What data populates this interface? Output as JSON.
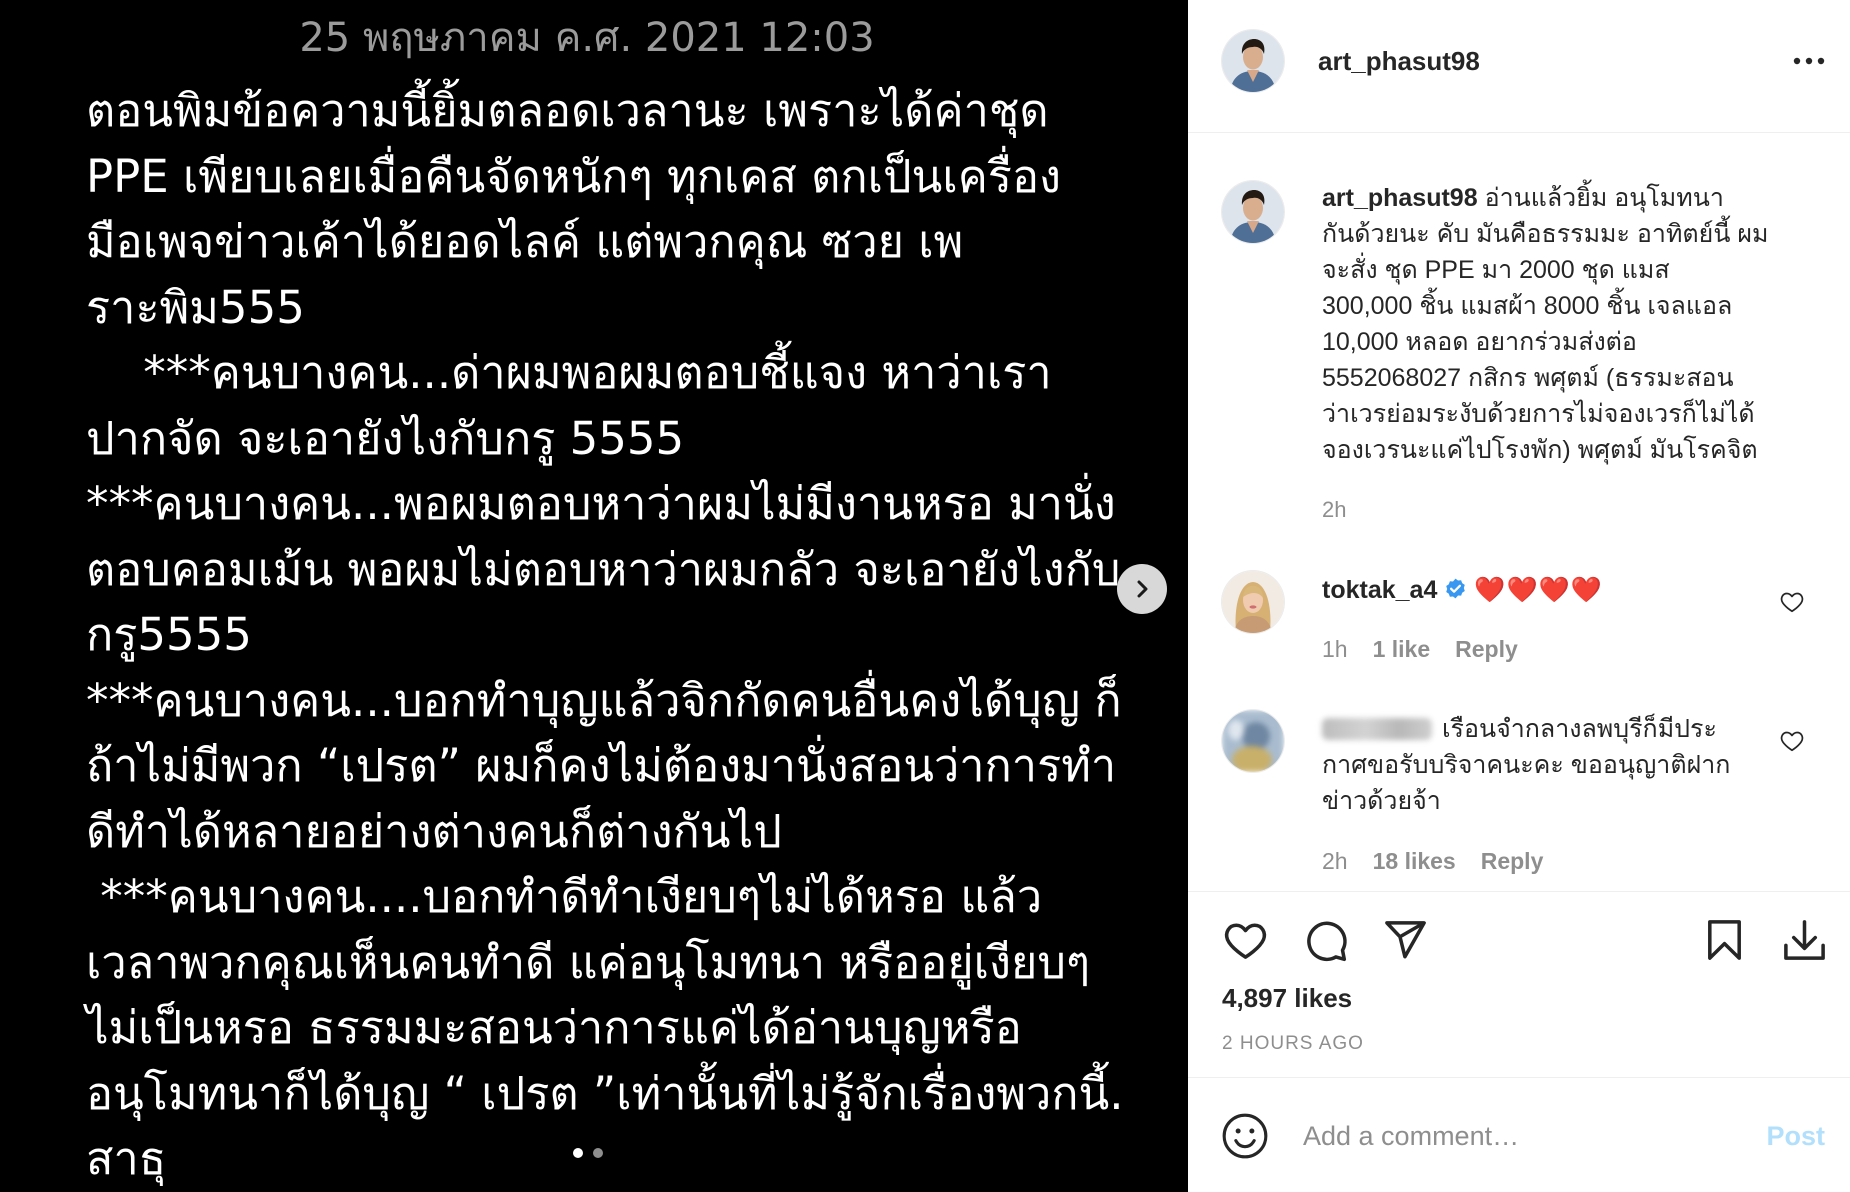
{
  "post_image": {
    "date": "25 พฤษภาคม ค.ศ. 2021 12:03",
    "lines": [
      "ตอนพิมข้อความนี้ยิ้มตลอดเวลานะ เพราะได้ค่าชุด",
      "PPE เพียบเลยเมื่อคืนจัดหนักๆ ทุกเคส ตกเป็นเครื่อง",
      "มือเพจข่าวเค้าได้ยอดไลค์ แต่พวกคุณ ซวย เพ",
      "ราะพิม555",
      "    ***คนบางคน...ด่าผมพอผมตอบชี้แจง หาว่าเรา",
      "ปากจัด จะเอายังไงกับกรู 5555",
      "***คนบางคน...พอผมตอบหาว่าผมไม่มีงานหรอ มานั่ง",
      "ตอบคอมเม้น พอผมไม่ตอบหาว่าผมกลัว จะเอายังไงกับ",
      "กรู5555",
      "***คนบางคน...บอกทำบุญแล้วจิกกัดคนอื่นคงได้บุญ ก็",
      "ถ้าไม่มีพวก “เปรต” ผมก็คงไม่ต้องมานั่งสอนว่าการทำ",
      "ดีทำได้หลายอย่างต่างคนก็ต่างกันไป",
      " ***คนบางคน....บอกทำดีทำเงียบๆไม่ได้หรอ แล้ว",
      "เวลาพวกคุณเห็นคนทำดี แค่อนุโมทนา หรืออยู่เงียบๆ",
      "ไม่เป็นหรอ ธรรมมะสอนว่าการแค่ได้อ่านบุญหรือ",
      "อนุโมทนาก็ได้บุญ “ เปรต ”เท่านั้นที่ไม่รู้จักเรื่องพวกนี้.",
      "สาธุ"
    ]
  },
  "carousel": {
    "next_icon": "chevron-right-icon",
    "page_count": 2,
    "current_page": 1
  },
  "header": {
    "avatar_icon": "profile-avatar",
    "username": "art_phasut98",
    "more_icon": "more-horizontal-icon"
  },
  "caption": {
    "username": "art_phasut98",
    "lines": [
      "อ่านแล้วยิ้ม อนุโมทนา",
      "กันด้วยนะ คับ มันคือธรรมมะ อาทิตย์นี้ ผม",
      "จะสั่ง ชุด PPE มา 2000 ชุด แมส",
      "300,000 ชิ้น แมสผ้า 8000 ชิ้น เจลแอล",
      "10,000 หลอด อยากร่วมส่งต่อ",
      "5552068027 กสิกร พศุตม์ (ธรรมะสอน",
      "ว่าเวรย่อมระงับด้วยการไม่จองเวรก็ไม่ได้",
      "จองเวรนะแค่ไปโรงพัก) พศุตม์ มันโรคจิต"
    ],
    "time": "2h"
  },
  "comments": [
    {
      "username": "toktak_a4",
      "verified": true,
      "text": "❤️❤️❤️❤️",
      "time": "1h",
      "likes": "1 like",
      "reply": "Reply",
      "like_icon": "heart-outline-icon"
    },
    {
      "username_blurred": true,
      "lines": [
        "เรือนจำกลางลพบุรีก็มีประ",
        "กาศขอรับบริจาคนะคะ ขออนุญาติฝาก",
        "ข่าวด้วยจ้า"
      ],
      "time": "2h",
      "likes": "18 likes",
      "reply": "Reply",
      "like_icon": "heart-outline-icon"
    }
  ],
  "actions": {
    "like_icon": "heart-outline-icon",
    "comment_icon": "comment-bubble-icon",
    "share_icon": "paper-plane-icon",
    "save_icon": "bookmark-icon",
    "download_icon": "download-icon"
  },
  "likes": "4,897 likes",
  "timestamp": "2 HOURS AGO",
  "comment_box": {
    "emoji_icon": "smiley-icon",
    "placeholder": "Add a comment…",
    "post_label": "Post"
  },
  "colors": {
    "text": "#262626",
    "secondary": "#8e8e8e",
    "post_button_disabled": "#b2dffc",
    "verified": "#3897f0",
    "hearts": "#ed4956",
    "divider": "#efefef",
    "image_background": "#000000"
  }
}
